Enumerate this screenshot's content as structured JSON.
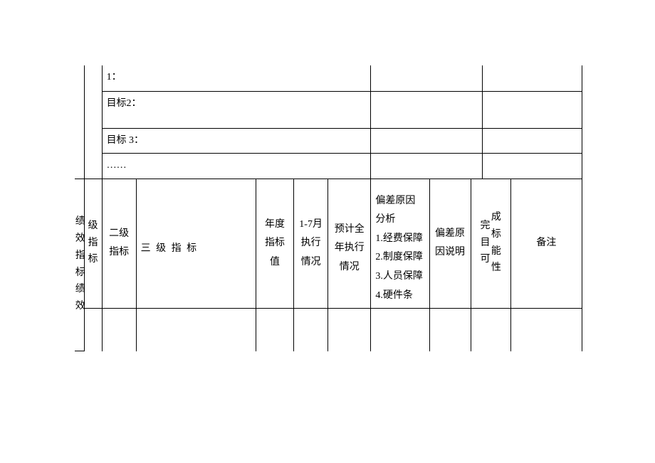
{
  "rows": {
    "r1": "1：",
    "r2": "目标2：",
    "r3": "目标 3：",
    "r4": "……"
  },
  "side": {
    "vertical_main": "绩效指标绩效",
    "level1": "级指标"
  },
  "headers": {
    "level2": "二级指标",
    "level3": "三 级 指 标",
    "annual_value": "年度指标值",
    "jan_jul": "1-7月执行情况",
    "full_year_est": "预计全年执行情况",
    "deviation_analysis": "偏差原因分析\n1.经费保障\n2.制度保障\n3.人员保障\n4.硬件条",
    "deviation_explain": "偏差原因说明",
    "complete_possibility": "完成目标可能性",
    "remark": "备注"
  }
}
